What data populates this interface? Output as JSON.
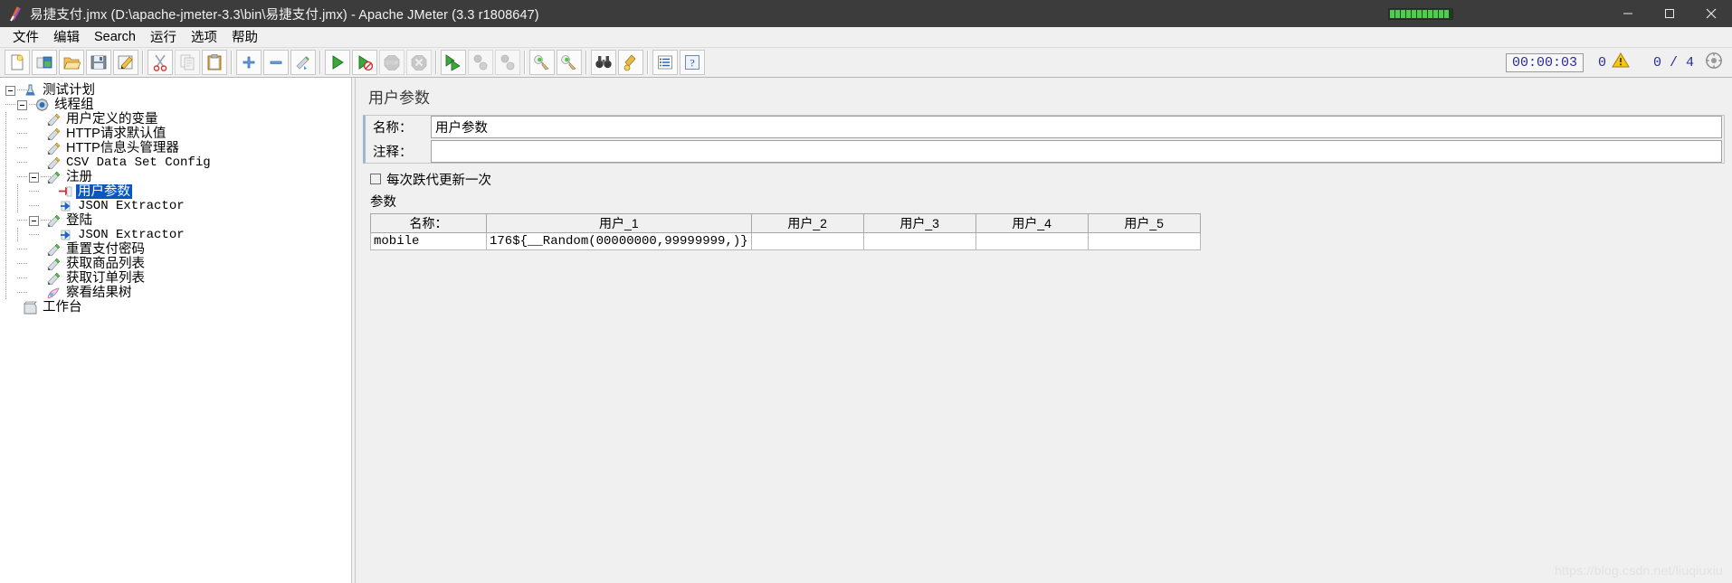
{
  "window": {
    "title": "易捷支付.jmx (D:\\apache-jmeter-3.3\\bin\\易捷支付.jmx) - Apache JMeter (3.3 r1808647)",
    "app_icon": "jmeter-feather-icon",
    "minimize_label": "—",
    "maximize_label": "▢",
    "close_label": "✕",
    "progress_blocks": 11
  },
  "menubar": {
    "items": [
      {
        "label": "文件",
        "name": "menu-file"
      },
      {
        "label": "编辑",
        "name": "menu-edit"
      },
      {
        "label": "Search",
        "name": "menu-search"
      },
      {
        "label": "运行",
        "name": "menu-run"
      },
      {
        "label": "选项",
        "name": "menu-options"
      },
      {
        "label": "帮助",
        "name": "menu-help"
      }
    ]
  },
  "toolbar": {
    "buttons": [
      {
        "name": "new-button",
        "icon": "new-document-icon",
        "disabled": false
      },
      {
        "name": "templates-button",
        "icon": "templates-icon",
        "disabled": false
      },
      {
        "name": "open-button",
        "icon": "open-folder-icon",
        "disabled": false
      },
      {
        "name": "save-button",
        "icon": "save-floppy-icon",
        "disabled": false
      },
      {
        "name": "save-as-button",
        "icon": "save-as-pencil-icon",
        "disabled": false
      },
      {
        "sep": true
      },
      {
        "name": "cut-button",
        "icon": "scissors-icon",
        "disabled": false
      },
      {
        "name": "copy-button",
        "icon": "copy-icon",
        "disabled": true
      },
      {
        "name": "paste-button",
        "icon": "clipboard-paste-icon",
        "disabled": false
      },
      {
        "sep": true
      },
      {
        "name": "expand-all-button",
        "icon": "plus-icon",
        "disabled": false
      },
      {
        "name": "collapse-all-button",
        "icon": "minus-icon",
        "disabled": false
      },
      {
        "name": "toggle-button",
        "icon": "toggle-pencil-icon",
        "disabled": false
      },
      {
        "sep": true
      },
      {
        "name": "start-button",
        "icon": "play-green-icon",
        "disabled": false
      },
      {
        "name": "start-no-timers-button",
        "icon": "play-no-pause-icon",
        "disabled": false
      },
      {
        "name": "stop-button",
        "icon": "stop-sign-icon",
        "disabled": true
      },
      {
        "name": "shutdown-button",
        "icon": "shutdown-icon",
        "disabled": true
      },
      {
        "sep": true
      },
      {
        "name": "remote-start-button",
        "icon": "remote-play-icon",
        "disabled": false
      },
      {
        "name": "remote-stop-button",
        "icon": "remote-stop-icon",
        "disabled": true
      },
      {
        "name": "remote-shutdown-button",
        "icon": "remote-shutdown-icon",
        "disabled": true
      },
      {
        "sep": true
      },
      {
        "name": "clear-button",
        "icon": "clear-broom-icon",
        "disabled": false
      },
      {
        "name": "clear-all-button",
        "icon": "clear-all-broom-icon",
        "disabled": false
      },
      {
        "sep": true
      },
      {
        "name": "search-button",
        "icon": "binoculars-icon",
        "disabled": false
      },
      {
        "name": "search-reset-button",
        "icon": "search-reset-icon",
        "disabled": false
      },
      {
        "sep": true
      },
      {
        "name": "function-helper-button",
        "icon": "function-list-icon",
        "disabled": false
      },
      {
        "name": "help-button",
        "icon": "help-question-icon",
        "disabled": false
      }
    ],
    "status": {
      "elapsed_time": "00:00:03",
      "warning_count": "0",
      "warning_icon": "warning-triangle-icon",
      "threads": "0 / 4",
      "thread_icon": "thread-indicator-icon"
    }
  },
  "tree": {
    "nodes": [
      {
        "name": "tree-node-test-plan",
        "label": "测试计划",
        "depth": 0,
        "icon": "test-plan-icon",
        "toggle": "minus",
        "selected": false,
        "mono": false
      },
      {
        "name": "tree-node-thread-group",
        "label": "线程组",
        "depth": 1,
        "icon": "thread-group-icon",
        "toggle": "minus",
        "selected": false,
        "mono": false
      },
      {
        "name": "tree-node-user-defined-vars",
        "label": "用户定义的变量",
        "depth": 2,
        "icon": "config-element-icon",
        "toggle": "none",
        "selected": false,
        "mono": false
      },
      {
        "name": "tree-node-http-defaults",
        "label": "HTTP请求默认值",
        "depth": 2,
        "icon": "config-element-icon",
        "toggle": "none",
        "selected": false,
        "mono": false
      },
      {
        "name": "tree-node-http-header-mgr",
        "label": "HTTP信息头管理器",
        "depth": 2,
        "icon": "config-element-icon",
        "toggle": "none",
        "selected": false,
        "mono": false
      },
      {
        "name": "tree-node-csv-data-set",
        "label": "CSV Data Set Config",
        "depth": 2,
        "icon": "config-element-icon",
        "toggle": "none",
        "selected": false,
        "mono": true
      },
      {
        "name": "tree-node-register",
        "label": "注册",
        "depth": 2,
        "icon": "http-sampler-icon",
        "toggle": "minus",
        "selected": false,
        "mono": false
      },
      {
        "name": "tree-node-user-parameters",
        "label": "用户参数",
        "depth": 3,
        "icon": "user-parameters-icon",
        "toggle": "none",
        "selected": true,
        "mono": false
      },
      {
        "name": "tree-node-json-extractor-1",
        "label": "JSON Extractor",
        "depth": 3,
        "icon": "post-processor-icon",
        "toggle": "none",
        "selected": false,
        "mono": true
      },
      {
        "name": "tree-node-login",
        "label": "登陆",
        "depth": 2,
        "icon": "http-sampler-icon",
        "toggle": "minus",
        "selected": false,
        "mono": false
      },
      {
        "name": "tree-node-json-extractor-2",
        "label": "JSON Extractor",
        "depth": 3,
        "icon": "post-processor-icon",
        "toggle": "none",
        "selected": false,
        "mono": true
      },
      {
        "name": "tree-node-reset-pay-pwd",
        "label": "重置支付密码",
        "depth": 2,
        "icon": "http-sampler-icon",
        "toggle": "none",
        "selected": false,
        "mono": false
      },
      {
        "name": "tree-node-get-goods-list",
        "label": "获取商品列表",
        "depth": 2,
        "icon": "http-sampler-icon",
        "toggle": "none",
        "selected": false,
        "mono": false
      },
      {
        "name": "tree-node-get-order-list",
        "label": "获取订单列表",
        "depth": 2,
        "icon": "http-sampler-icon",
        "toggle": "none",
        "selected": false,
        "mono": false
      },
      {
        "name": "tree-node-view-results-tree",
        "label": "察看结果树",
        "depth": 2,
        "icon": "listener-icon",
        "toggle": "none",
        "selected": false,
        "mono": false
      },
      {
        "name": "tree-node-workbench",
        "label": "工作台",
        "depth": 0,
        "icon": "workbench-icon",
        "toggle": "none",
        "selected": false,
        "mono": false
      }
    ]
  },
  "panel": {
    "title": "用户参数",
    "name_label": "名称：",
    "name_value": "用户参数",
    "comment_label": "注释：",
    "comment_value": "",
    "update_once_label": "每次跌代更新一次",
    "update_once_checked": false,
    "params_section_label": "参数",
    "table": {
      "headers": [
        "名称：",
        "用户_1",
        "用户_2",
        "用户_3",
        "用户_4",
        "用户_5"
      ],
      "rows": [
        [
          "mobile",
          "176${__Random(00000000,99999999,)}",
          "",
          "",
          "",
          ""
        ]
      ]
    }
  },
  "watermark": "https://blog.csdn.net/liuqiuxiu",
  "colors": {
    "titlebar_bg": "#3c3c3c",
    "selection_blue": "#0a57c4",
    "panel_bg": "#f0f0f0",
    "field_bg": "#ffffff",
    "accent_green": "#49d049"
  }
}
